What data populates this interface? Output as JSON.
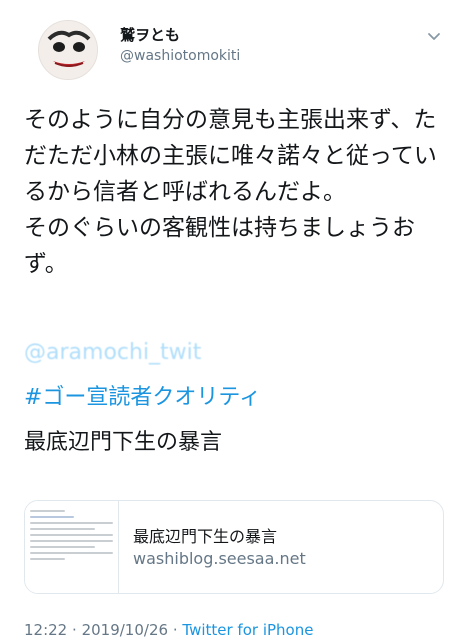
{
  "author": {
    "display_name": "鷲ヲとも",
    "handle": "@washiotomokiti"
  },
  "tweet": {
    "body": "そのように自分の意見も主張出来ず、ただただ小林の主張に唯々諾々と従っているから信者と呼ばれるんだよ。\nそのぐらいの客観性は持ちましょうおず。",
    "mention": "@aramochi_twit",
    "hashtag": "#ゴー宣読者クオリティ",
    "extra_line": "最底辺門下生の暴言"
  },
  "link_card": {
    "title": "最底辺門下生の暴言",
    "domain": "washiblog.seesaa.net"
  },
  "meta": {
    "time": "12:22",
    "sep1": "·",
    "date": "2019/10/26",
    "sep2": "·",
    "source": "Twitter for iPhone"
  },
  "colors": {
    "link": "#1b95e0",
    "text": "#14171a",
    "muted": "#657786",
    "border": "#e1e8ed"
  },
  "icons": {
    "caret": "chevron-down-icon"
  }
}
